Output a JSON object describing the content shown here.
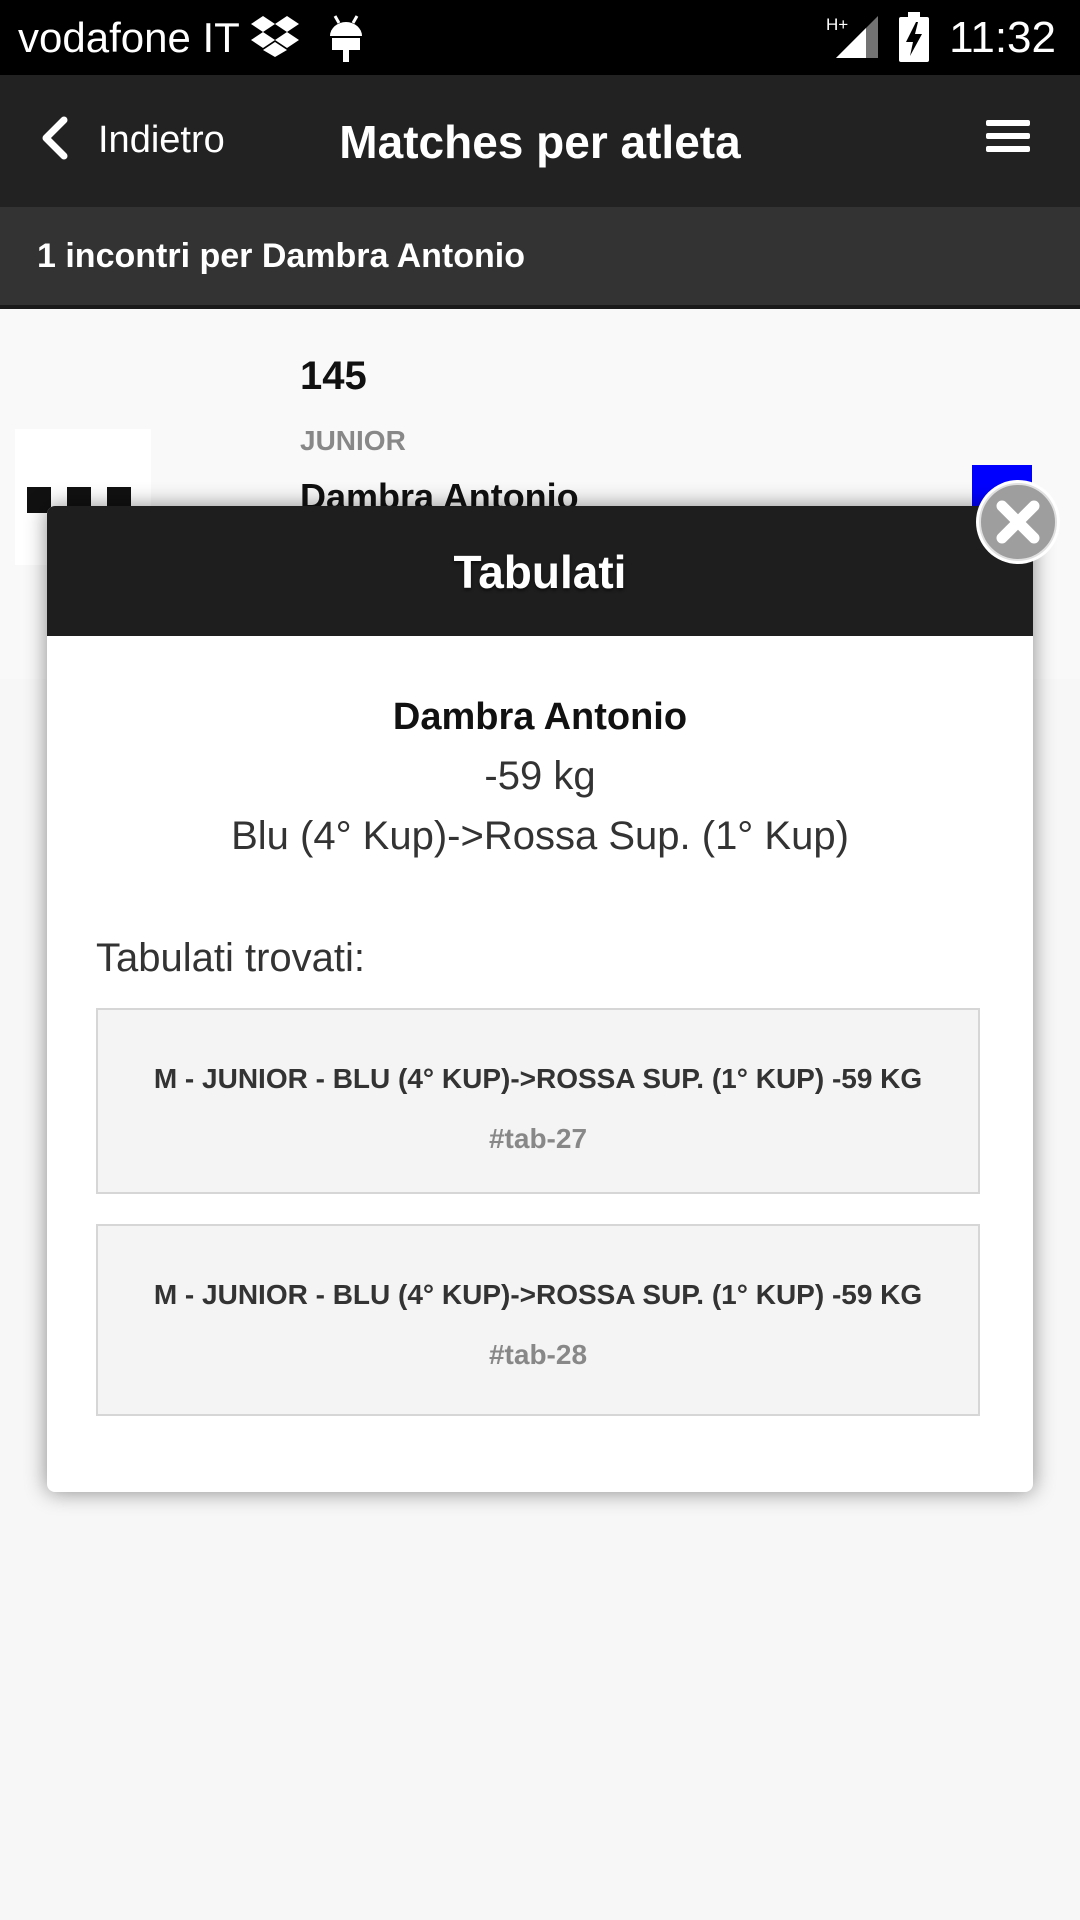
{
  "status_bar": {
    "carrier": "vodafone IT",
    "network_type": "H+",
    "time": "11:32",
    "icons": [
      "dropbox-icon",
      "android-icon",
      "signal-icon",
      "battery-charging-icon"
    ]
  },
  "header": {
    "back_label": "Indietro",
    "title": "Matches per atleta",
    "menu_icon": "hamburger-menu-icon"
  },
  "subheader": {
    "text": "1 incontri per Dambra Antonio"
  },
  "list_row": {
    "number": "145",
    "category": "JUNIOR",
    "name": "Dambra Antonio",
    "marker_color": "#0000ff"
  },
  "dialog": {
    "title": "Tabulati",
    "athlete_name": "Dambra Antonio",
    "weight": "-59 kg",
    "belt": "Blu (4° Kup)->Rossa Sup. (1° Kup)",
    "found_label": "Tabulati trovati:",
    "tabs": [
      {
        "title": "M - JUNIOR - BLU (4° KUP)->ROSSA SUP. (1° KUP) -59 KG",
        "id": "#tab-27"
      },
      {
        "title": "M - JUNIOR - BLU (4° KUP)->ROSSA SUP. (1° KUP) -59 KG",
        "id": "#tab-28"
      }
    ],
    "close_icon": "close-icon"
  },
  "colors": {
    "header_bg": "#222222",
    "subheader_bg": "#333333",
    "dialog_header_bg": "#1e1e1e",
    "accent_blue": "#0000ff"
  }
}
